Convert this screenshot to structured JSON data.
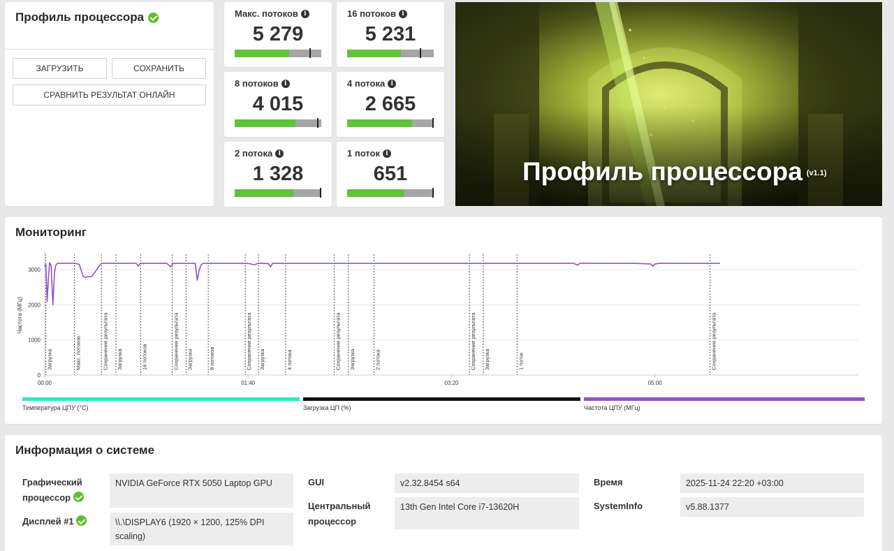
{
  "profile": {
    "title": "Профиль процессора",
    "load_button": "ЗАГРУЗИТЬ",
    "save_button": "СОХРАНИТЬ",
    "compare_button": "СРАВНИТЬ РЕЗУЛЬТАТ ОНЛАЙН"
  },
  "scores": [
    {
      "label": "Макс. потоков",
      "value": "5 279",
      "fill_fraction": 0.63,
      "marker_fraction": 0.87
    },
    {
      "label": "16 потоков",
      "value": "5 231",
      "fill_fraction": 0.62,
      "marker_fraction": 0.85
    },
    {
      "label": "8 потоков",
      "value": "4 015",
      "fill_fraction": 0.7,
      "marker_fraction": 0.96
    },
    {
      "label": "4 потока",
      "value": "2 665",
      "fill_fraction": 0.75,
      "marker_fraction": 0.99
    },
    {
      "label": "2 потока",
      "value": "1 328",
      "fill_fraction": 0.68,
      "marker_fraction": 0.99
    },
    {
      "label": "1 поток",
      "value": "651",
      "fill_fraction": 0.65,
      "marker_fraction": 0.99
    }
  ],
  "hero": {
    "title": "Профиль процессора",
    "version": "(v1.1)"
  },
  "monitoring": {
    "title": "Мониторинг",
    "legend": [
      {
        "label": "Температура ЦПУ (°C)",
        "color": "#2ee8c6"
      },
      {
        "label": "Загрузка ЦП (%)",
        "color": "#111111"
      },
      {
        "label": "Частота ЦПУ (МГц)",
        "color": "#9351c7"
      }
    ]
  },
  "chart_data": {
    "type": "line",
    "ylabel": "Частота (МГц)",
    "ylim": [
      0,
      3400
    ],
    "yticks": [
      "0",
      "1000",
      "2000",
      "3000"
    ],
    "xlim": [
      0,
      400
    ],
    "xtick_labels": [
      "00:00",
      "01:40",
      "03:20",
      "05:00"
    ],
    "xtick_values": [
      0,
      100,
      200,
      300
    ],
    "series": [
      {
        "name": "Частота ЦПУ (МГц)",
        "color": "#9351c7",
        "x": [
          0,
          0.6,
          1.2,
          1.8,
          2.4,
          3.2,
          4.0,
          4.8,
          5.4,
          6.2,
          7.0,
          8.0,
          10,
          12,
          15,
          17,
          19,
          20,
          21,
          23,
          25,
          27,
          28,
          30,
          35,
          40,
          45,
          46,
          47,
          50,
          55,
          60,
          62,
          63,
          65,
          70,
          74,
          75,
          76,
          77,
          78,
          80,
          85,
          90,
          95,
          100,
          103,
          105,
          108,
          110,
          111,
          112,
          120,
          130,
          140,
          150,
          160,
          170,
          180,
          190,
          200,
          210,
          220,
          230,
          240,
          250,
          260,
          262,
          263,
          265,
          280,
          290,
          298,
          299,
          300,
          302,
          310,
          320,
          332
        ],
        "y": [
          3080,
          3150,
          2100,
          2700,
          3200,
          3100,
          2000,
          2900,
          3120,
          3180,
          3180,
          3180,
          3180,
          3180,
          3180,
          3150,
          2800,
          2780,
          2800,
          2800,
          2950,
          3120,
          3180,
          3180,
          3180,
          3180,
          3180,
          3100,
          3180,
          3180,
          3180,
          3180,
          3080,
          3180,
          3180,
          3180,
          3180,
          2700,
          3000,
          3150,
          3180,
          3180,
          3180,
          3180,
          3180,
          3180,
          3140,
          3180,
          3180,
          3170,
          3080,
          3180,
          3180,
          3180,
          3180,
          3180,
          3180,
          3180,
          3180,
          3180,
          3180,
          3180,
          3180,
          3180,
          3180,
          3180,
          3180,
          3130,
          3180,
          3180,
          3180,
          3180,
          3160,
          3100,
          3160,
          3180,
          3180,
          3180,
          3180
        ]
      }
    ],
    "markers": [
      {
        "x": 0.5,
        "label": "Загрузка"
      },
      {
        "x": 14.6,
        "label": "Макс. потоков"
      },
      {
        "x": 27.9,
        "label": "Сохранение результата"
      },
      {
        "x": 35.0,
        "label": "Загрузка"
      },
      {
        "x": 47.2,
        "label": "16 потоков"
      },
      {
        "x": 62.7,
        "label": "Сохранение результата"
      },
      {
        "x": 69.5,
        "label": "Загрузка"
      },
      {
        "x": 80.4,
        "label": "8 потоков"
      },
      {
        "x": 98.6,
        "label": "Сохранение результата"
      },
      {
        "x": 105.1,
        "label": "Загрузка"
      },
      {
        "x": 118.4,
        "label": "4 потока"
      },
      {
        "x": 142.3,
        "label": "Сохранение результата"
      },
      {
        "x": 149.3,
        "label": "Загрузка"
      },
      {
        "x": 161.9,
        "label": "2 потока"
      },
      {
        "x": 208.8,
        "label": "Сохранение результата"
      },
      {
        "x": 215.6,
        "label": "Загрузка"
      },
      {
        "x": 232.2,
        "label": "1 поток"
      },
      {
        "x": 327.1,
        "label": "Сохранение результата"
      }
    ]
  },
  "sysinfo": {
    "title": "Информация о системе",
    "gpu_label": "Графический процессор",
    "gpu_value": "NVIDIA GeForce RTX 5050 Laptop GPU",
    "display_label": "Дисплей #1",
    "display_value": "\\\\.\\DISPLAY6 (1920 × 1200, 125% DPI scaling)",
    "gui_label": "GUI",
    "gui_value": "v2.32.8454 s64",
    "cpu_label": "Центральный процессор",
    "cpu_value": "13th Gen Intel Core i7-13620H",
    "time_label": "Время",
    "time_value": "2025-11-24 22:20 +03:00",
    "sysinfo_label": "SystemInfo",
    "sysinfo_value": "v5.88.1377"
  }
}
